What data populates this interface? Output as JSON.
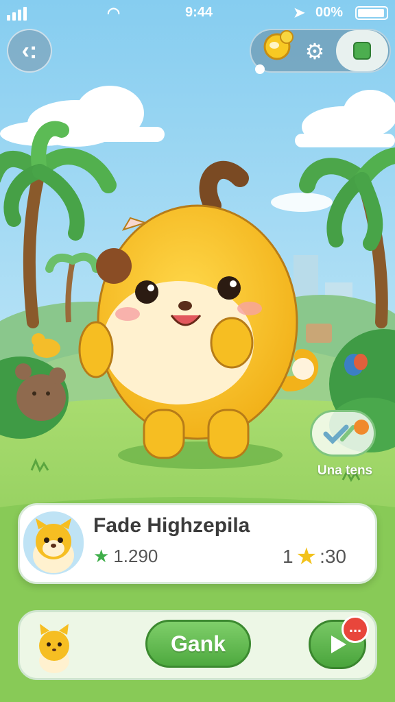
{
  "status_bar": {
    "time": "9:44",
    "battery_percent": "00%",
    "icons": [
      "signal-icon",
      "wifi-icon",
      "location-arrow-icon",
      "battery-icon"
    ]
  },
  "top_controls": {
    "icons": [
      "back-icon",
      "coin-icon",
      "gear-icon",
      "green-square-icon"
    ]
  },
  "side_badge": {
    "label": "Una tens",
    "icon": "chat-check-icon"
  },
  "pet_card": {
    "name": "Fade Highzepila",
    "score": "1.290",
    "stars_level": "1",
    "stars_count": ":30"
  },
  "bottom_bar": {
    "main_button_label": "Gank",
    "notification_count": "...",
    "play_icon": "play-icon"
  },
  "colors": {
    "sky": "#8fd3f4",
    "grass": "#8ccf5a",
    "pet_yellow": "#f7c32b",
    "button_green": "#4ea93f",
    "badge_red": "#e8463b"
  }
}
